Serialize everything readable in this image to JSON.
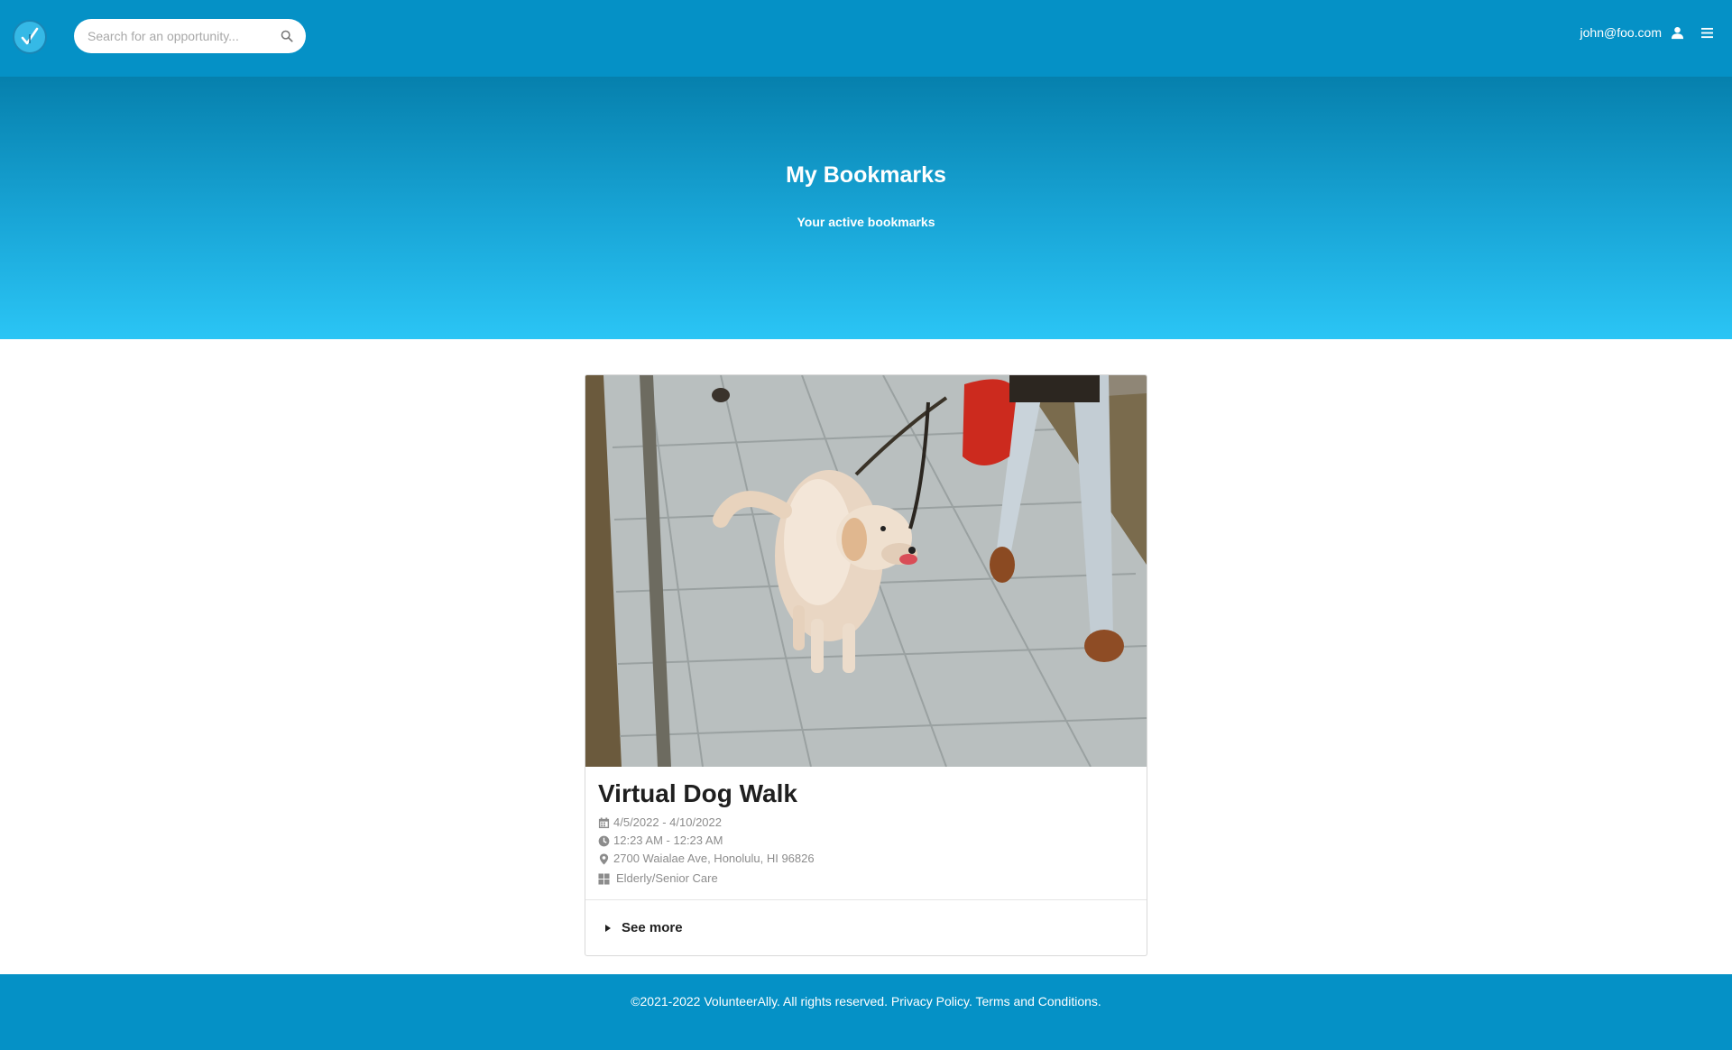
{
  "navbar": {
    "logo_icon": "volunteerally-check-logo-icon",
    "search": {
      "placeholder": "Search for an opportunity...",
      "value": "",
      "icon": "search-icon"
    },
    "user_email": "john@foo.com",
    "user_icon": "user-icon",
    "menu_icon": "hamburger-menu-icon"
  },
  "hero": {
    "title": "My Bookmarks",
    "subtitle": "Your active bookmarks"
  },
  "bookmarks": [
    {
      "image": "dog-walk-photo",
      "title": "Virtual Dog Walk",
      "date_range": "4/5/2022 - 4/10/2022",
      "time_range": "12:23 AM - 12:23 AM",
      "address": "2700 Waialae Ave, Honolulu, HI 96826",
      "category": "Elderly/Senior Care",
      "see_more_label": "See more"
    }
  ],
  "footer": {
    "copyright": "©2021-2022 VolunteerAlly. All rights reserved.",
    "privacy_label": "Privacy Policy.",
    "terms_label": "Terms and Conditions."
  },
  "colors": {
    "nav_bg": "#0591c6",
    "hero_top": "#0680ad",
    "hero_bottom": "#2bc5f5",
    "footer_bg": "#0591c6",
    "meta_text": "#8c8c8c"
  }
}
